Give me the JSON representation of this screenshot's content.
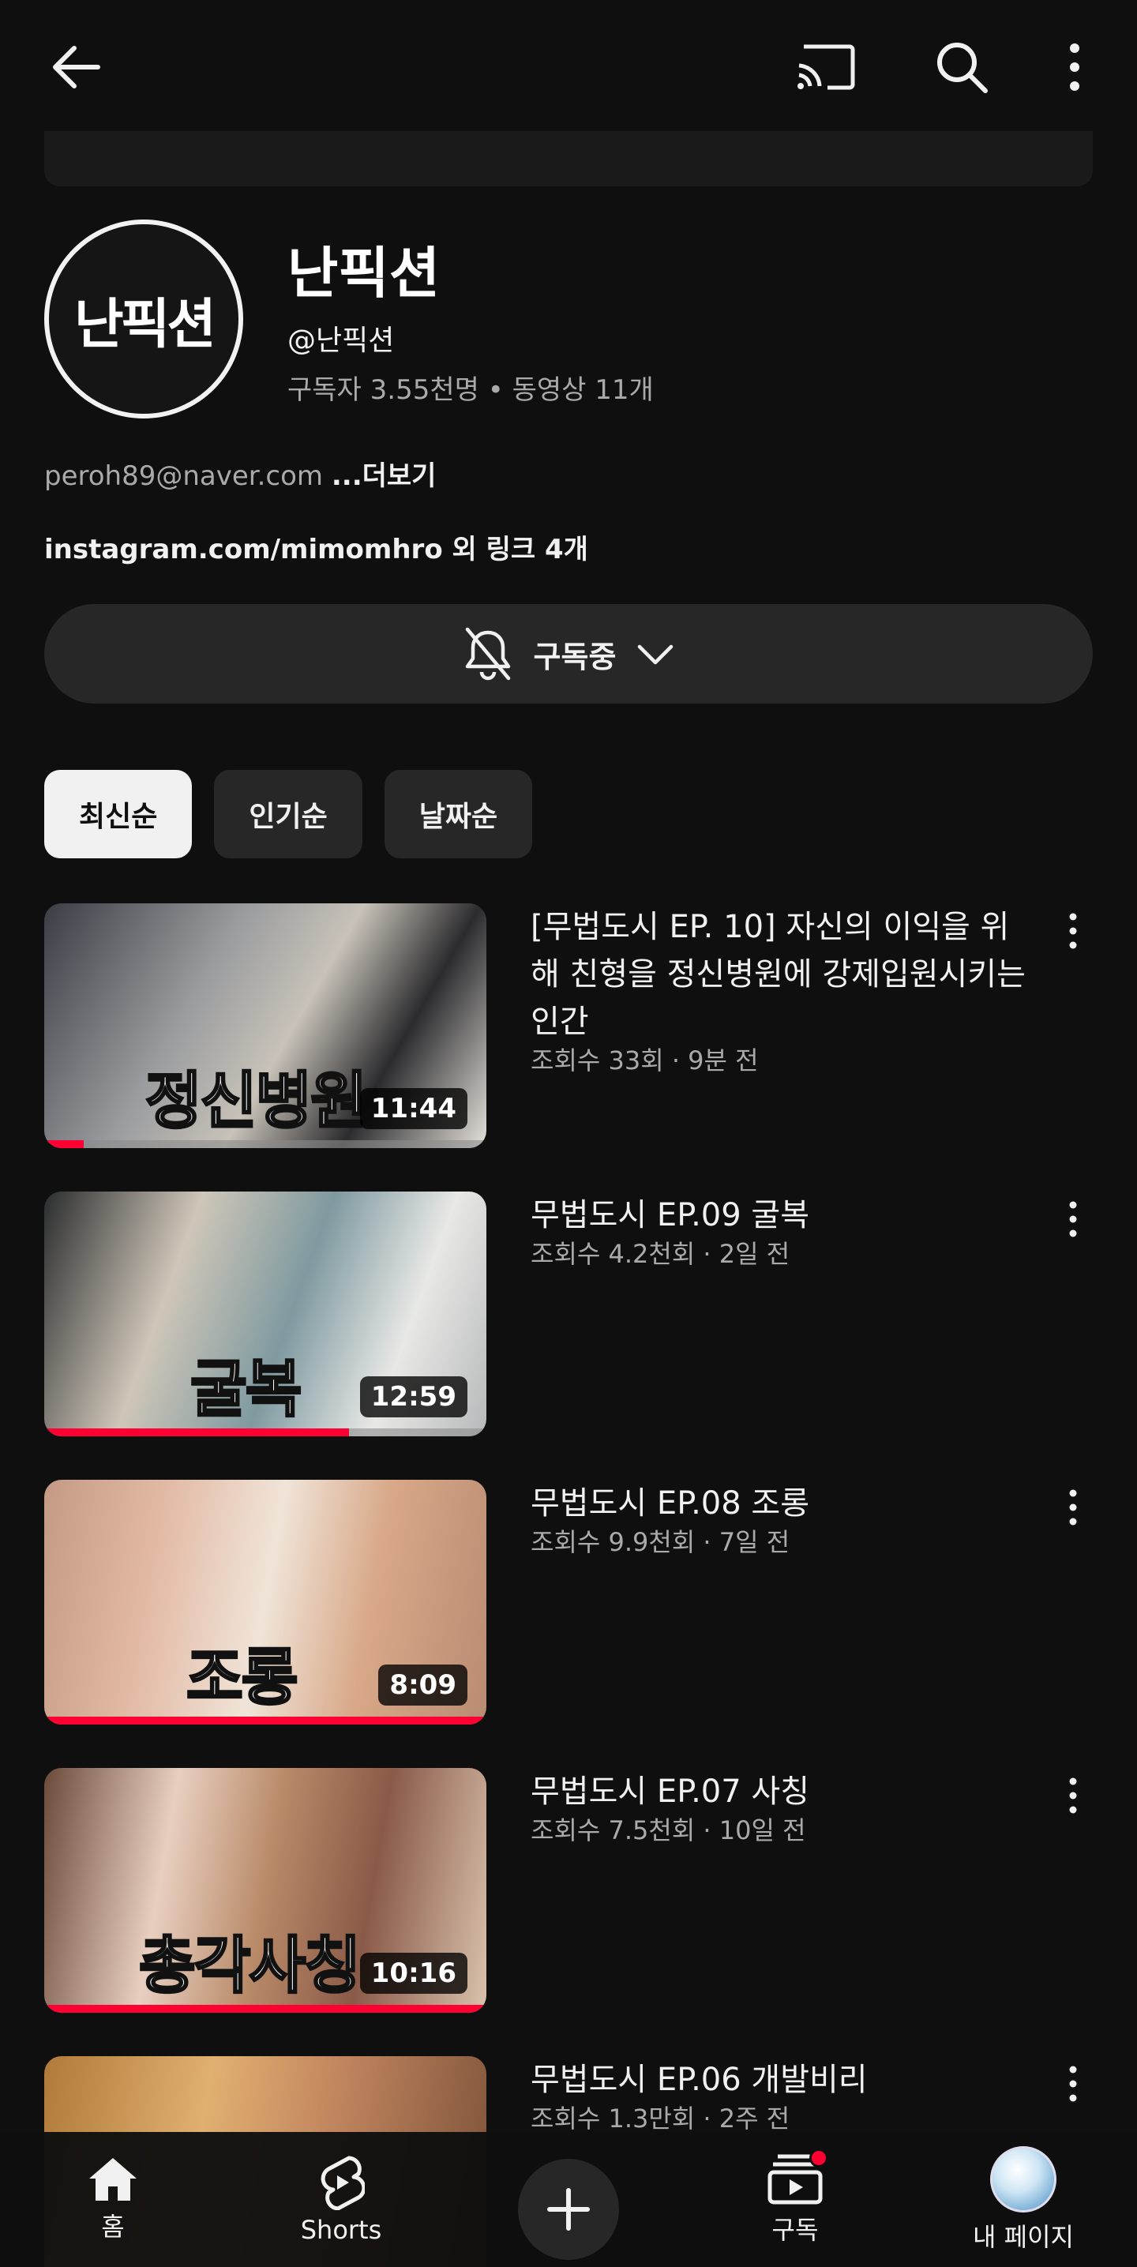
{
  "channel": {
    "name": "난픽션",
    "avatar_text": "난픽션",
    "handle": "@난픽션",
    "stats": "구독자 3.55천명 • 동영상 11개",
    "description": "peroh89@naver.com",
    "description_more": "...더보기",
    "links": "instagram.com/mimomhro 외 링크 4개"
  },
  "subscribe": {
    "label": "구독중"
  },
  "chips": [
    "최신순",
    "인기순",
    "날짜순"
  ],
  "videos": [
    {
      "title": "[무법도시 EP. 10] 자신의 이익을 위해 친형을 정신병원에 강제입원시키는 인간",
      "meta": "조회수 33회 · 9분 전",
      "duration": "11:44",
      "caption": "정신병원",
      "progress": 0.09
    },
    {
      "title": "무법도시 EP.09 굴복",
      "meta": "조회수 4.2천회 · 2일 전",
      "duration": "12:59",
      "caption": "굴복",
      "progress": 0.69
    },
    {
      "title": "무법도시 EP.08 조롱",
      "meta": "조회수 9.9천회 · 7일 전",
      "duration": "8:09",
      "caption": "조롱",
      "progress": 1.0
    },
    {
      "title": "무법도시 EP.07 사칭",
      "meta": "조회수 7.5천회 · 10일 전",
      "duration": "10:16",
      "caption": "총각사칭",
      "progress": 1.0
    },
    {
      "title": "무법도시 EP.06 개발비리",
      "meta": "조회수 1.3만회 · 2주 전"
    }
  ],
  "nav": {
    "home": "홈",
    "shorts": "Shorts",
    "subscriptions": "구독",
    "you": "내 페이지"
  },
  "colors": {
    "accent": "#ff0033",
    "background": "#0f0f0f",
    "chip": "#272727"
  }
}
